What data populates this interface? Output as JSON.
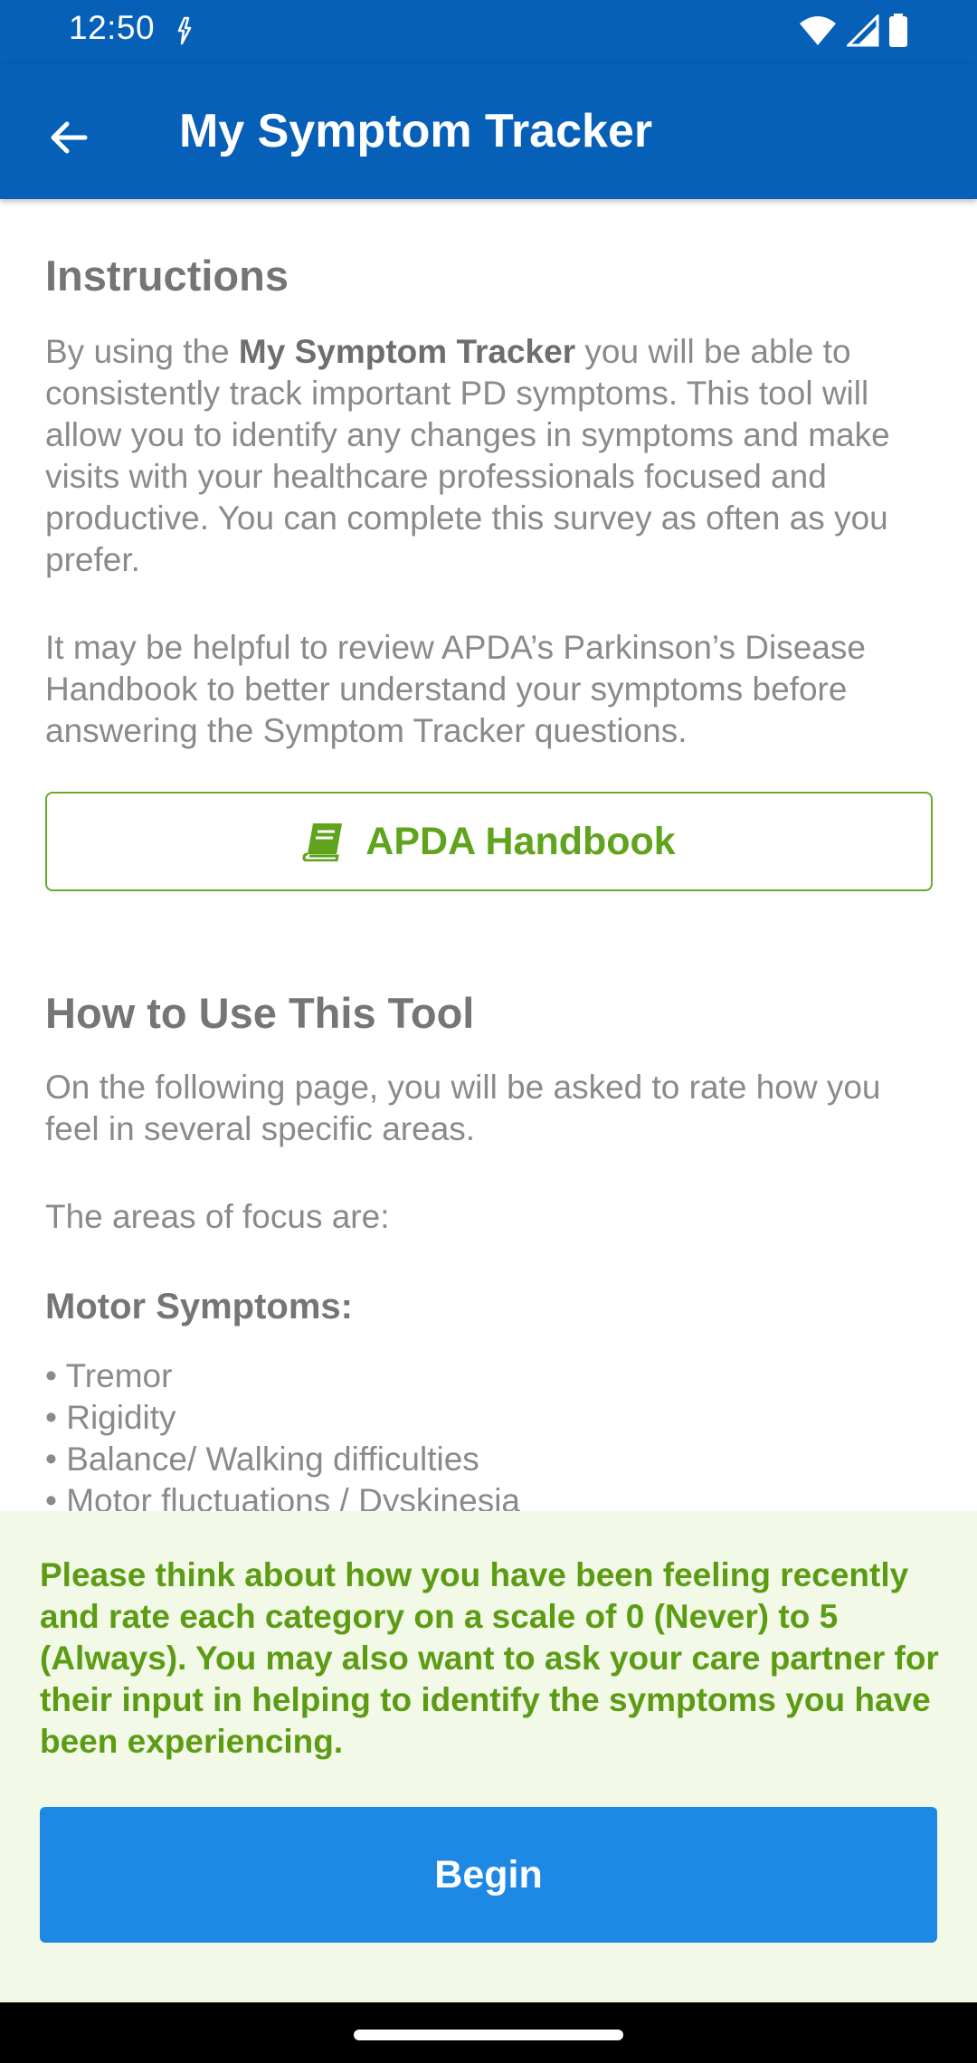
{
  "status_bar": {
    "time": "12:50",
    "icons": [
      "data-saver-icon",
      "wifi-icon",
      "signal-icon",
      "battery-icon"
    ]
  },
  "app_bar": {
    "back_icon": "arrow-left-icon",
    "title": "My Symptom Tracker"
  },
  "instructions": {
    "heading": "Instructions",
    "para1_prefix": "By using the ",
    "para1_bold": "My Symptom Tracker",
    "para1_suffix": " you will be able to consistently track important PD symptoms. This tool will allow you to identify any changes in symptoms and make visits with your healthcare professionals focused and productive. You can complete this survey as often as you prefer.",
    "para2": "It may be helpful to review APDA’s Parkinson’s Disease Handbook to better understand your symptoms before answering the Symptom Tracker questions."
  },
  "handbook_button": {
    "icon": "book-icon",
    "label": "APDA Handbook"
  },
  "how_to": {
    "heading": "How to Use This Tool",
    "para1": "On the following page, you will be asked to rate how you feel in several specific areas.",
    "para2": "The areas of focus are:",
    "motor_heading": "Motor Symptoms:",
    "motor_items": [
      "• Tremor",
      "• Rigidity",
      "• Balance/ Walking difficulties",
      "• Motor fluctuations / Dyskinesia"
    ]
  },
  "bottom_panel": {
    "prompt": "Please think about how you have been feeling recently and rate each category on a scale of 0 (Never) to 5 (Always). You may also want to ask your care partner for their input in helping to identify the symptoms you have been experiencing.",
    "begin_label": "Begin"
  },
  "colors": {
    "app_bar": "#0660b8",
    "accent_green": "#5fa41c",
    "begin_button": "#1e88e5",
    "panel_bg": "#f2f9e6"
  }
}
